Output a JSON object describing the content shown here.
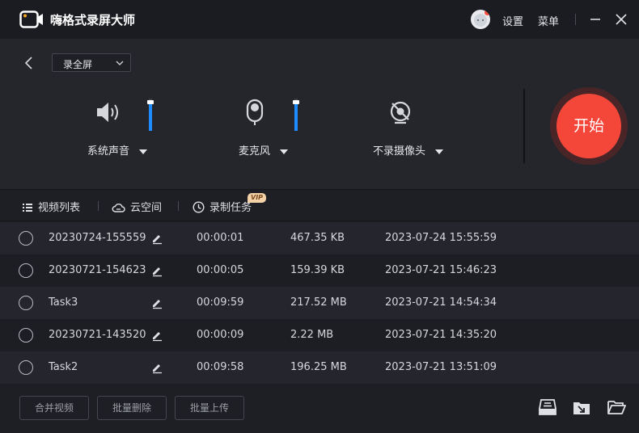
{
  "app": {
    "title": "嗨格式录屏大师"
  },
  "titlebar": {
    "settings_label": "设置",
    "menu_label": "菜单"
  },
  "capture": {
    "mode_label": "录全屏",
    "system_audio": {
      "label": "系统声音",
      "volume_level": 0.9
    },
    "microphone": {
      "label": "麦克风",
      "volume_level": 0.9
    },
    "camera": {
      "label": "不录摄像头"
    },
    "start_label": "开始"
  },
  "tabs": [
    {
      "label": "视频列表"
    },
    {
      "label": "云空间"
    },
    {
      "label": "录制任务",
      "badge": "VIP"
    }
  ],
  "recordings": [
    {
      "name": "20230724-155559",
      "duration": "00:00:01",
      "size": "467.35 KB",
      "date": "2023-07-24 15:55:59"
    },
    {
      "name": "20230721-154623",
      "duration": "00:00:05",
      "size": "159.39 KB",
      "date": "2023-07-21 15:46:23"
    },
    {
      "name": "Task3",
      "duration": "00:09:59",
      "size": "217.52 MB",
      "date": "2023-07-21 14:54:34"
    },
    {
      "name": "20230721-143520",
      "duration": "00:00:09",
      "size": "2.22 MB",
      "date": "2023-07-21 14:35:20"
    },
    {
      "name": "Task2",
      "duration": "00:09:58",
      "size": "196.25 MB",
      "date": "2023-07-21 13:51:09"
    }
  ],
  "footer": {
    "merge_label": "合并视频",
    "batch_delete_label": "批量删除",
    "batch_upload_label": "批量上传"
  },
  "colors": {
    "accent_blue": "#1e8cff",
    "start_red": "#f5463a",
    "vip_gold": "#f3d2a8"
  },
  "icons": [
    "camera-logo-icon",
    "minimize-icon",
    "close-icon",
    "back-arrow-icon",
    "speaker-icon",
    "microphone-icon",
    "camera-off-icon",
    "list-icon",
    "cloud-icon",
    "clock-icon",
    "edit-icon",
    "compress-icon",
    "export-icon",
    "folder-icon"
  ]
}
